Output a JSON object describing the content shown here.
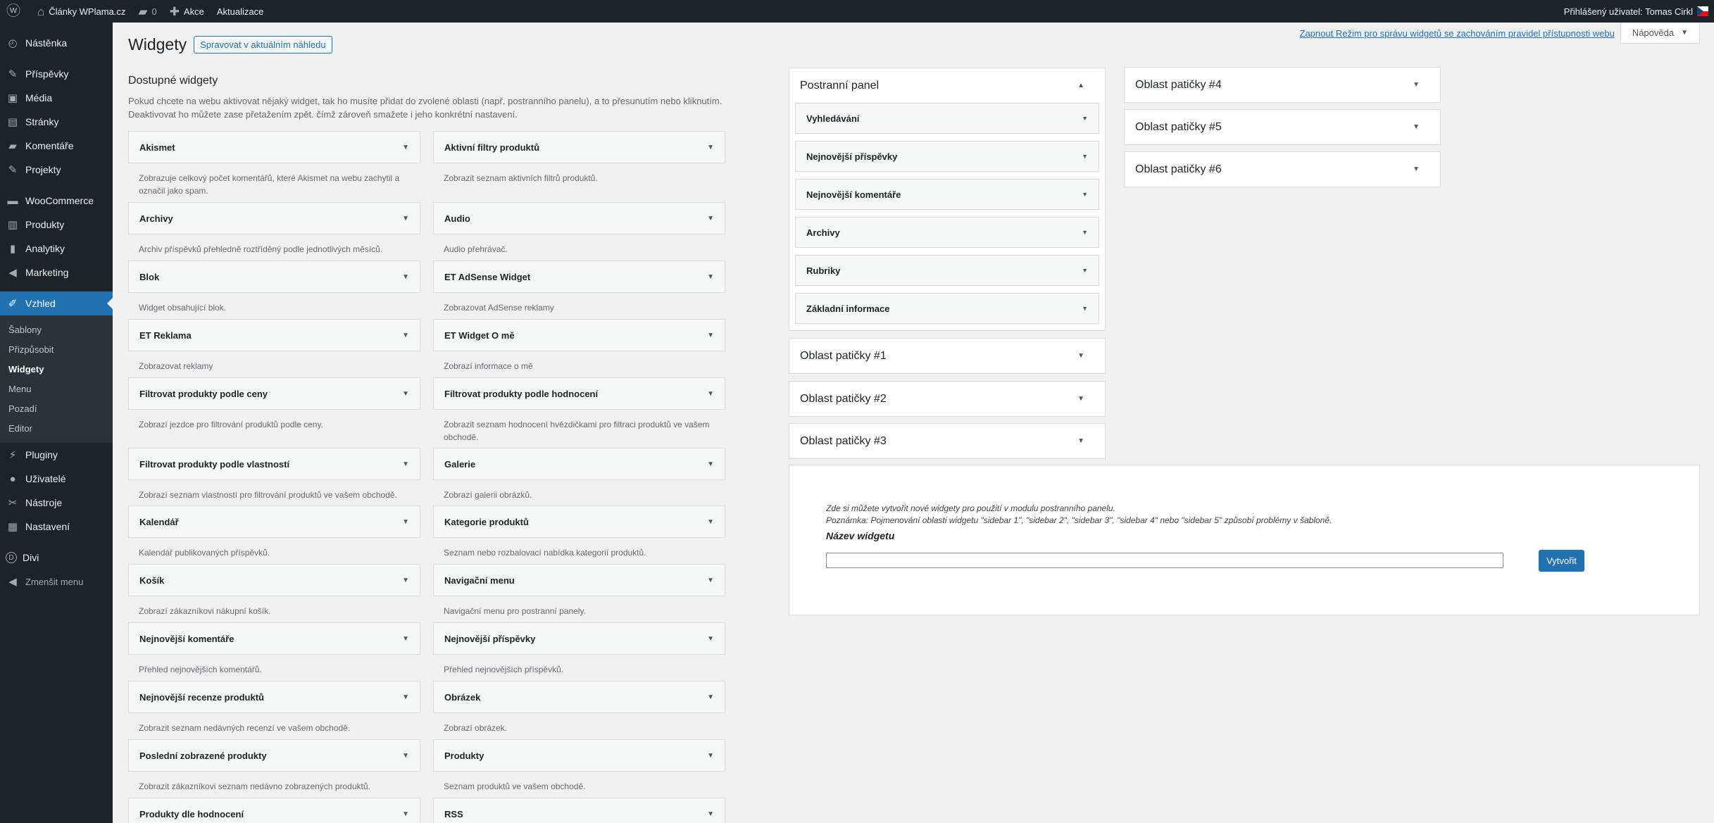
{
  "adminbar": {
    "site_name": "Články WPlama.cz",
    "comments_count": "0",
    "new_label": "Akce",
    "update_label": "Aktualizace",
    "user_label": "Přihlášený uživatel: Tomas Cirkl"
  },
  "sidebar": {
    "items": [
      {
        "label": "Nástěnka",
        "icon": "dashboard-icon",
        "glyph": "◴"
      },
      {
        "label": "Příspěvky",
        "icon": "pin-icon",
        "glyph": "✎"
      },
      {
        "label": "Média",
        "icon": "media-icon",
        "glyph": "▣"
      },
      {
        "label": "Stránky",
        "icon": "pages-icon",
        "glyph": "▤"
      },
      {
        "label": "Komentáře",
        "icon": "comments-icon",
        "glyph": "▰"
      },
      {
        "label": "Projekty",
        "icon": "pin-icon",
        "glyph": "✎"
      },
      {
        "label": "WooCommerce",
        "icon": "woocommerce-icon",
        "glyph": "▬"
      },
      {
        "label": "Produkty",
        "icon": "products-icon",
        "glyph": "▥"
      },
      {
        "label": "Analytiky",
        "icon": "analytics-icon",
        "glyph": "▮"
      },
      {
        "label": "Marketing",
        "icon": "megaphone-icon",
        "glyph": "◀"
      },
      {
        "label": "Vzhled",
        "icon": "brush-icon",
        "glyph": "✐"
      },
      {
        "label": "Pluginy",
        "icon": "plugin-icon",
        "glyph": "⚡"
      },
      {
        "label": "Uživatelé",
        "icon": "users-icon",
        "glyph": "●"
      },
      {
        "label": "Nástroje",
        "icon": "tools-icon",
        "glyph": "✂"
      },
      {
        "label": "Nastavení",
        "icon": "settings-icon",
        "glyph": "▦"
      },
      {
        "label": "Divi",
        "icon": "divi-icon",
        "glyph": "D"
      },
      {
        "label": "Zmenšit menu",
        "icon": "collapse-icon",
        "glyph": "◀"
      }
    ],
    "submenu": [
      "Šablony",
      "Přizpůsobit",
      "Widgety",
      "Menu",
      "Pozadí",
      "Editor"
    ]
  },
  "header": {
    "title": "Widgety",
    "manage_button": "Spravovat v aktuálním náhledu",
    "accessibility_link": "Zapnout Režim pro správu widgetů se zachováním pravidel přístupnosti webu",
    "help_tab": "Nápověda"
  },
  "available": {
    "title": "Dostupné widgety",
    "description": "Pokud chcete na webu aktivovat nějaký widget, tak ho musíte přidat do zvolené oblasti (např. postranního panelu), a to přesunutím nebo kliknutím. Deaktivovat ho můžete zase přetažením zpět. čímž zároveň smažete i jeho konkrétní nastavení.",
    "left": [
      {
        "name": "Akismet",
        "desc": "Zobrazuje celkový počet komentářů, které Akismet na webu zachytil a označil jako spam."
      },
      {
        "name": "Archivy",
        "desc": "Archiv příspěvků přehledně roztříděný podle jednotlivých měsíců."
      },
      {
        "name": "Blok",
        "desc": "Widget obsahující blok."
      },
      {
        "name": "ET Reklama",
        "desc": "Zobrazovat reklamy"
      },
      {
        "name": "Filtrovat produkty podle ceny",
        "desc": "Zobrazí jezdce pro filtrování produktů podle ceny."
      },
      {
        "name": "Filtrovat produkty podle vlastností",
        "desc": "Zobrazí seznam vlastností pro filtrování produktů ve vašem obchodě."
      },
      {
        "name": "Kalendář",
        "desc": "Kalendář publikovaných příspěvků."
      },
      {
        "name": "Košík",
        "desc": "Zobrazí zákazníkovi nákupní košík."
      },
      {
        "name": "Nejnovější komentáře",
        "desc": "Přehled nejnovějších komentářů."
      },
      {
        "name": "Nejnovější recenze produktů",
        "desc": "Zobrazit seznam nedávných recenzí ve vašem obchodě."
      },
      {
        "name": "Poslední zobrazené produkty",
        "desc": "Zobrazit zákazníkovi seznam nedávno zobrazených produktů."
      },
      {
        "name": "Produkty dle hodnocení",
        "desc": ""
      }
    ],
    "right": [
      {
        "name": "Aktivní filtry produktů",
        "desc": "Zobrazit seznam aktivních filtrů produktů."
      },
      {
        "name": "Audio",
        "desc": "Audio přehrávač."
      },
      {
        "name": "ET AdSense Widget",
        "desc": "Zobrazovat AdSense reklamy"
      },
      {
        "name": "ET Widget O mě",
        "desc": "Zobrazí informace o mě"
      },
      {
        "name": "Filtrovat produkty podle hodnocení",
        "desc": "Zobrazit seznam hodnocení hvězdičkami pro filtraci produktů ve vašem obchodě."
      },
      {
        "name": "Galerie",
        "desc": "Zobrazí galerii obrázků."
      },
      {
        "name": "Kategorie produktů",
        "desc": "Seznam nebo rozbalovací nabídka kategorií produktů."
      },
      {
        "name": "Navigační menu",
        "desc": "Navigační menu pro postranní panely."
      },
      {
        "name": "Nejnovější příspěvky",
        "desc": "Přehled nejnovějších příspěvků."
      },
      {
        "name": "Obrázek",
        "desc": "Zobrazí obrázek."
      },
      {
        "name": "Produkty",
        "desc": "Seznam produktů ve vašem obchodě."
      },
      {
        "name": "RSS",
        "desc": ""
      }
    ]
  },
  "areas": {
    "sidebar_panel": {
      "title": "Postranní panel",
      "widgets": [
        "Vyhledávání",
        "Nejnovější příspěvky",
        "Nejnovější komentáře",
        "Archivy",
        "Rubriky",
        "Základní informace"
      ]
    },
    "footer_1": "Oblast patičky #1",
    "footer_2": "Oblast patičky #2",
    "footer_3": "Oblast patičky #3",
    "footer_4": "Oblast patičky #4",
    "footer_5": "Oblast patičky #5",
    "footer_6": "Oblast patičky #6"
  },
  "create": {
    "line1": "Zde si můžete vytvořit nové widgety pro použití v modulu postranního panelu.",
    "line2": "Poznámka: Pojmenování oblasti widgetu \"sidebar 1\", \"sidebar 2\", \"sidebar 3\", \"sidebar 4\" nebo \"sidebar 5\" způsobí problémy v šabloně.",
    "name_label": "Název widgetu",
    "input_value": "",
    "button": "Vytvořit"
  }
}
